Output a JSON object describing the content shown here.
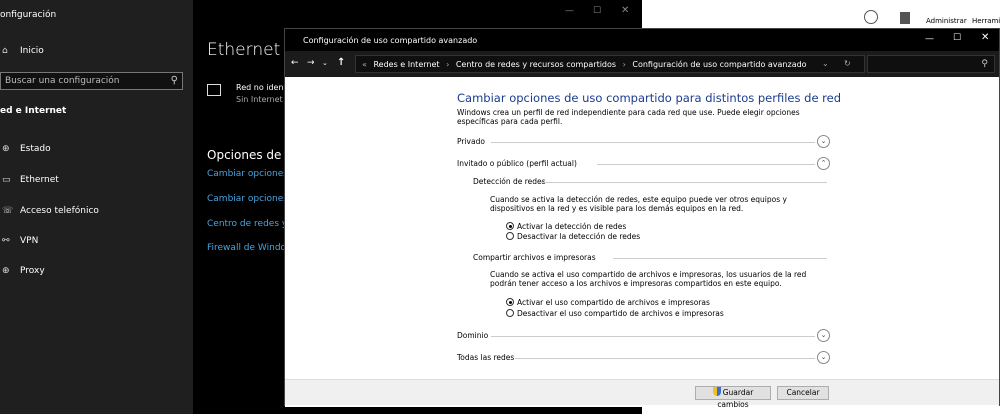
{
  "settings": {
    "title": "onfiguración",
    "nav_home": "Inicio",
    "search_placeholder": "Buscar una configuración",
    "section": "ed e Internet",
    "items": [
      {
        "label": "Estado",
        "icon": "globe-icon"
      },
      {
        "label": "Ethernet",
        "icon": "monitor-icon"
      },
      {
        "label": "Acceso telefónico",
        "icon": "dialup-icon"
      },
      {
        "label": "VPN",
        "icon": "vpn-icon"
      },
      {
        "label": "Proxy",
        "icon": "globe-icon"
      }
    ],
    "page_title": "Ethernet",
    "network_name": "Red no iden",
    "network_status": "Sin Internet",
    "options_heading": "Opciones de c",
    "links": [
      "Cambiar opciones d",
      "Cambiar opciones d",
      "Centro de redes y r",
      "Firewall de Window"
    ]
  },
  "background_windows": {
    "user_menu": [
      "Administrar",
      "Herrami"
    ]
  },
  "control_panel": {
    "title": "Configuración de uso compartido avanzado",
    "breadcrumb": [
      "Redes e Internet",
      "Centro de redes y recursos compartidos",
      "Configuración de uso compartido avanzado"
    ],
    "heading": "Cambiar opciones de uso compartido para distintos perfiles de red",
    "intro": "Windows crea un perfil de red independiente para cada red que use. Puede elegir opciones específicas para cada perfil.",
    "profiles": {
      "private": "Privado",
      "guest": "Invitado o público (perfil actual)",
      "domain": "Dominio",
      "all": "Todas las redes"
    },
    "discovery": {
      "title": "Detección de redes",
      "desc": "Cuando se activa la detección de redes, este equipo puede ver otros equipos y dispositivos en la red y es visible para los demás equipos en la red.",
      "opt_on": "Activar la detección de redes",
      "opt_off": "Desactivar la detección de redes",
      "selected": "on"
    },
    "sharing": {
      "title": "Compartir archivos e impresoras",
      "desc": "Cuando se activa el uso compartido de archivos e impresoras, los usuarios de la red podrán tener acceso a los archivos e impresoras compartidos en este equipo.",
      "opt_on": "Activar el uso compartido de archivos e impresoras",
      "opt_off": "Desactivar el uso compartido de archivos e impresoras",
      "selected": "on"
    },
    "save_label": "Guardar cambios",
    "cancel_label": "Cancelar"
  }
}
